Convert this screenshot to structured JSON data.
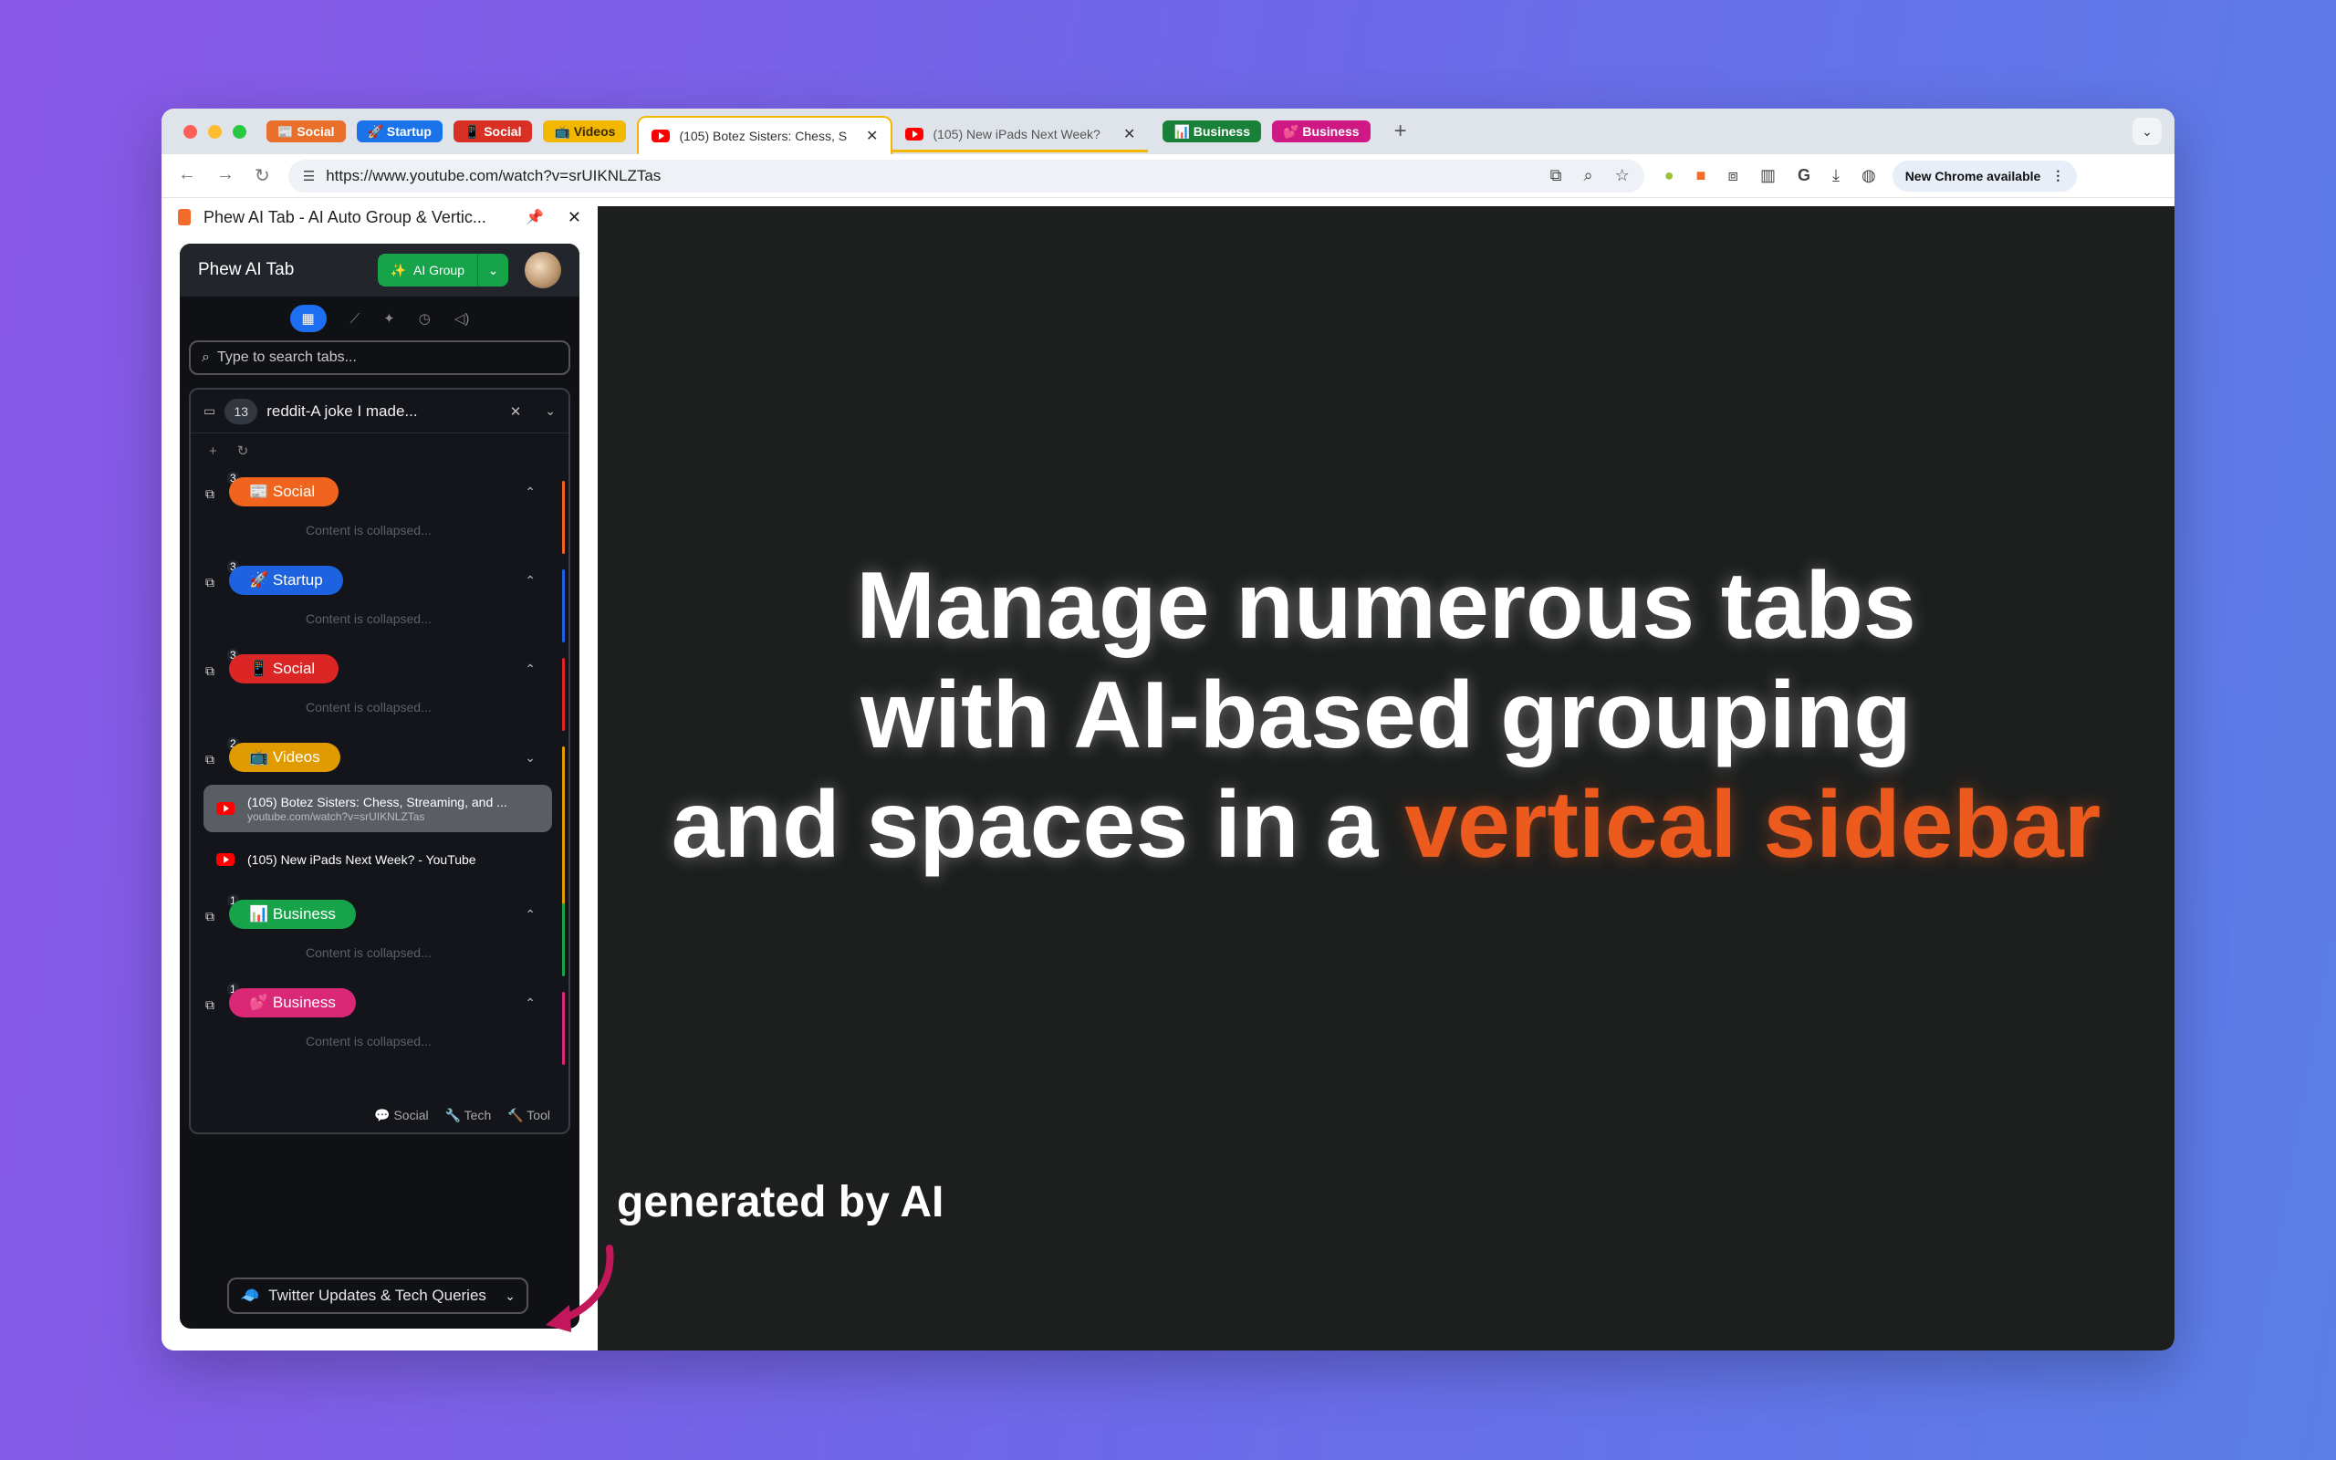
{
  "browser": {
    "tab_groups": [
      {
        "label": "📰 Social",
        "color": "#e8702a"
      },
      {
        "label": "🚀 Startup",
        "color": "#1a73e8"
      },
      {
        "label": "📱 Social",
        "color": "#d93025"
      },
      {
        "label": "📺 Videos",
        "color": "#f2b700"
      }
    ],
    "tab_groups_right": [
      {
        "label": "📊 Business",
        "color": "#188038"
      },
      {
        "label": "💕 Business",
        "color": "#d01884"
      }
    ],
    "tabs": [
      {
        "title": "(105) Botez Sisters: Chess, S",
        "active": true
      },
      {
        "title": "(105) New iPads Next Week?",
        "active": false
      }
    ],
    "url": "https://www.youtube.com/watch?v=srUIKNLZTas",
    "new_chrome": "New Chrome available"
  },
  "sidepanel": {
    "header_title": "Phew AI Tab - AI Auto Group & Vertic...",
    "app_title": "Phew AI Tab",
    "ai_group_label": "AI Group",
    "search_placeholder": "Type to search tabs...",
    "space": {
      "count": "13",
      "title": "reddit-A joke I made...",
      "collapsed_text": "Content is collapsed...",
      "groups": [
        {
          "label": "📰 Social",
          "count": "3",
          "color": "#f0641e",
          "collapsed": true
        },
        {
          "label": "🚀 Startup",
          "count": "3",
          "color": "#1d62e0",
          "collapsed": true
        },
        {
          "label": "📱 Social",
          "count": "3",
          "color": "#dc2626",
          "collapsed": true
        },
        {
          "label": "📺 Videos",
          "count": "2",
          "color": "#e09b00",
          "collapsed": false
        },
        {
          "label": "📊 Business",
          "count": "1",
          "color": "#16a34a",
          "collapsed": true
        },
        {
          "label": "💕 Business",
          "count": "1",
          "color": "#db2777",
          "collapsed": true
        }
      ],
      "video_tabs": [
        {
          "title": "(105) Botez Sisters: Chess, Streaming, and ...",
          "url": "youtube.com/watch?v=srUIKNLZTas"
        },
        {
          "title": "(105) New iPads Next Week? - YouTube",
          "url": ""
        }
      ],
      "footer": [
        "💬 Social",
        "🔧 Tech",
        "🔨 Tool"
      ]
    },
    "space_selector": "Twitter Updates & Tech Queries"
  },
  "headline": {
    "line1": "Manage numerous tabs",
    "line2": "with AI-based grouping",
    "line3_prefix": "and spaces in a ",
    "line3_highlight": "vertical sidebar"
  },
  "caption": "generated by AI"
}
